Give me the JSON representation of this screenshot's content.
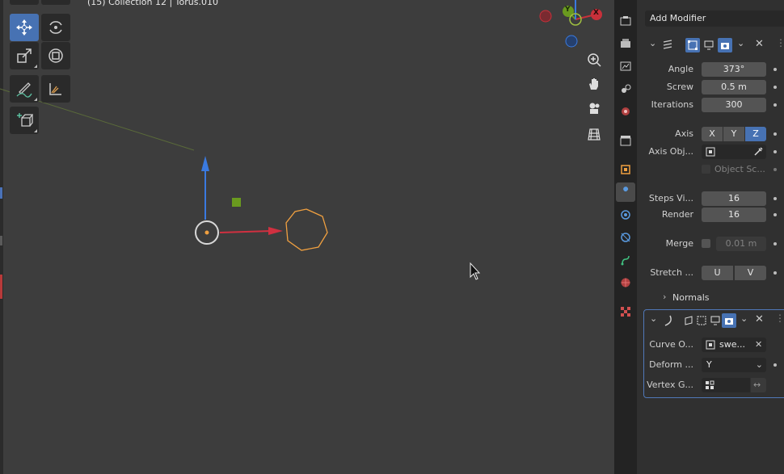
{
  "viewport": {
    "header_text": "(15) Collection 12 | Torus.010",
    "gizmo": {
      "x_label": "X",
      "y_label": "Y"
    }
  },
  "properties": {
    "add_modifier": "Add Modifier",
    "screw": {
      "angle_label": "Angle",
      "angle_value": "373°",
      "screw_label": "Screw",
      "screw_value": "0.5 m",
      "iterations_label": "Iterations",
      "iterations_value": "300",
      "axis_label": "Axis",
      "axis_x": "X",
      "axis_y": "Y",
      "axis_z": "Z",
      "axis_obj_label": "Axis Obj...",
      "object_screw_label": "Object Sc...",
      "steps_viewport_label": "Steps Vi...",
      "steps_viewport_value": "16",
      "render_label": "Render",
      "render_value": "16",
      "merge_label": "Merge",
      "merge_value": "0.01 m",
      "stretch_label": "Stretch ...",
      "stretch_u": "U",
      "stretch_v": "V",
      "normals_label": "Normals"
    },
    "curve": {
      "curve_object_label": "Curve O...",
      "curve_object_value": "swe...",
      "deform_label": "Deform ...",
      "deform_value": "Y",
      "vertex_group_label": "Vertex G..."
    }
  },
  "colors": {
    "accent": "#4772b3",
    "x_axis": "#c8303a",
    "y_axis": "#6a9a1f",
    "z_axis": "#3a7ae0",
    "selected": "#f0a040"
  }
}
